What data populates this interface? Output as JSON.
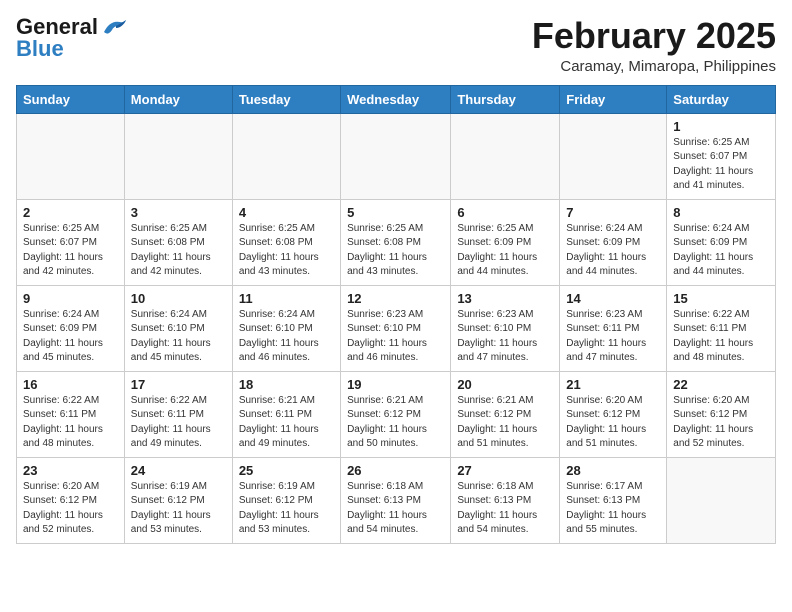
{
  "header": {
    "logo_general": "General",
    "logo_blue": "Blue",
    "month": "February 2025",
    "location": "Caramay, Mimaropa, Philippines"
  },
  "weekdays": [
    "Sunday",
    "Monday",
    "Tuesday",
    "Wednesday",
    "Thursday",
    "Friday",
    "Saturday"
  ],
  "weeks": [
    [
      {
        "day": "",
        "info": ""
      },
      {
        "day": "",
        "info": ""
      },
      {
        "day": "",
        "info": ""
      },
      {
        "day": "",
        "info": ""
      },
      {
        "day": "",
        "info": ""
      },
      {
        "day": "",
        "info": ""
      },
      {
        "day": "1",
        "info": "Sunrise: 6:25 AM\nSunset: 6:07 PM\nDaylight: 11 hours\nand 41 minutes."
      }
    ],
    [
      {
        "day": "2",
        "info": "Sunrise: 6:25 AM\nSunset: 6:07 PM\nDaylight: 11 hours\nand 42 minutes."
      },
      {
        "day": "3",
        "info": "Sunrise: 6:25 AM\nSunset: 6:08 PM\nDaylight: 11 hours\nand 42 minutes."
      },
      {
        "day": "4",
        "info": "Sunrise: 6:25 AM\nSunset: 6:08 PM\nDaylight: 11 hours\nand 43 minutes."
      },
      {
        "day": "5",
        "info": "Sunrise: 6:25 AM\nSunset: 6:08 PM\nDaylight: 11 hours\nand 43 minutes."
      },
      {
        "day": "6",
        "info": "Sunrise: 6:25 AM\nSunset: 6:09 PM\nDaylight: 11 hours\nand 44 minutes."
      },
      {
        "day": "7",
        "info": "Sunrise: 6:24 AM\nSunset: 6:09 PM\nDaylight: 11 hours\nand 44 minutes."
      },
      {
        "day": "8",
        "info": "Sunrise: 6:24 AM\nSunset: 6:09 PM\nDaylight: 11 hours\nand 44 minutes."
      }
    ],
    [
      {
        "day": "9",
        "info": "Sunrise: 6:24 AM\nSunset: 6:09 PM\nDaylight: 11 hours\nand 45 minutes."
      },
      {
        "day": "10",
        "info": "Sunrise: 6:24 AM\nSunset: 6:10 PM\nDaylight: 11 hours\nand 45 minutes."
      },
      {
        "day": "11",
        "info": "Sunrise: 6:24 AM\nSunset: 6:10 PM\nDaylight: 11 hours\nand 46 minutes."
      },
      {
        "day": "12",
        "info": "Sunrise: 6:23 AM\nSunset: 6:10 PM\nDaylight: 11 hours\nand 46 minutes."
      },
      {
        "day": "13",
        "info": "Sunrise: 6:23 AM\nSunset: 6:10 PM\nDaylight: 11 hours\nand 47 minutes."
      },
      {
        "day": "14",
        "info": "Sunrise: 6:23 AM\nSunset: 6:11 PM\nDaylight: 11 hours\nand 47 minutes."
      },
      {
        "day": "15",
        "info": "Sunrise: 6:22 AM\nSunset: 6:11 PM\nDaylight: 11 hours\nand 48 minutes."
      }
    ],
    [
      {
        "day": "16",
        "info": "Sunrise: 6:22 AM\nSunset: 6:11 PM\nDaylight: 11 hours\nand 48 minutes."
      },
      {
        "day": "17",
        "info": "Sunrise: 6:22 AM\nSunset: 6:11 PM\nDaylight: 11 hours\nand 49 minutes."
      },
      {
        "day": "18",
        "info": "Sunrise: 6:21 AM\nSunset: 6:11 PM\nDaylight: 11 hours\nand 49 minutes."
      },
      {
        "day": "19",
        "info": "Sunrise: 6:21 AM\nSunset: 6:12 PM\nDaylight: 11 hours\nand 50 minutes."
      },
      {
        "day": "20",
        "info": "Sunrise: 6:21 AM\nSunset: 6:12 PM\nDaylight: 11 hours\nand 51 minutes."
      },
      {
        "day": "21",
        "info": "Sunrise: 6:20 AM\nSunset: 6:12 PM\nDaylight: 11 hours\nand 51 minutes."
      },
      {
        "day": "22",
        "info": "Sunrise: 6:20 AM\nSunset: 6:12 PM\nDaylight: 11 hours\nand 52 minutes."
      }
    ],
    [
      {
        "day": "23",
        "info": "Sunrise: 6:20 AM\nSunset: 6:12 PM\nDaylight: 11 hours\nand 52 minutes."
      },
      {
        "day": "24",
        "info": "Sunrise: 6:19 AM\nSunset: 6:12 PM\nDaylight: 11 hours\nand 53 minutes."
      },
      {
        "day": "25",
        "info": "Sunrise: 6:19 AM\nSunset: 6:12 PM\nDaylight: 11 hours\nand 53 minutes."
      },
      {
        "day": "26",
        "info": "Sunrise: 6:18 AM\nSunset: 6:13 PM\nDaylight: 11 hours\nand 54 minutes."
      },
      {
        "day": "27",
        "info": "Sunrise: 6:18 AM\nSunset: 6:13 PM\nDaylight: 11 hours\nand 54 minutes."
      },
      {
        "day": "28",
        "info": "Sunrise: 6:17 AM\nSunset: 6:13 PM\nDaylight: 11 hours\nand 55 minutes."
      },
      {
        "day": "",
        "info": ""
      }
    ]
  ]
}
